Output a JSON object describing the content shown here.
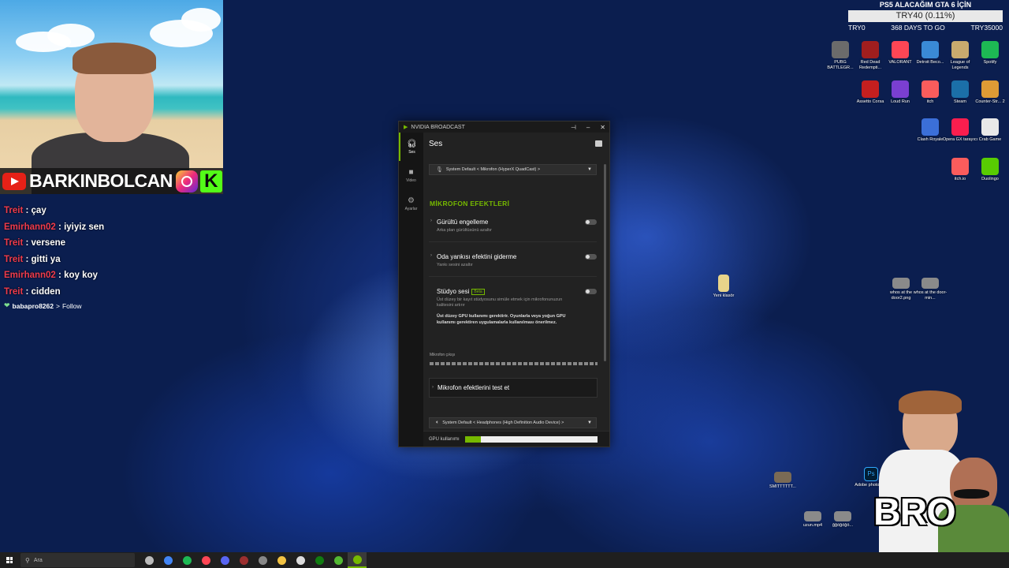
{
  "webcam": {
    "channel_name": "BARKINBOLCAN",
    "kick_letter": "K"
  },
  "chat": {
    "messages": [
      {
        "user": "Treit",
        "text": "çay"
      },
      {
        "user": "Emirhann02",
        "text": "iyiyiz sen"
      },
      {
        "user": "Treit",
        "text": "versene"
      },
      {
        "user": "Treit",
        "text": "gitti ya"
      },
      {
        "user": "Emirhann02",
        "text": "koy koy"
      },
      {
        "user": "Treit",
        "text": "cidden"
      }
    ],
    "follow": {
      "user": "babapro8262",
      "text": "Follow"
    },
    "separator": " : "
  },
  "goal": {
    "title": "PS5 ALACAĞIM GTA 6 İÇİN",
    "progress_text": "TRY40 (0.11%)",
    "start": "TRY0",
    "days_left": "368 DAYS TO GO",
    "target": "TRY35000"
  },
  "desktop_icons": {
    "row1": [
      {
        "label": "PUBG BATTLEGR...",
        "color": "#6b6b6b"
      },
      {
        "label": "Red Dead Redempti...",
        "color": "#a01e1e"
      },
      {
        "label": "VALORANT",
        "color": "#ff4655"
      },
      {
        "label": "Detroit Beco...",
        "color": "#3a8ad6"
      },
      {
        "label": "League of Legends",
        "color": "#c8aa6e"
      },
      {
        "label": "Spotify",
        "color": "#1db954"
      }
    ],
    "row2": [
      {
        "label": "Assetto Corsa",
        "color": "#c41f1f"
      },
      {
        "label": "Loud Run",
        "color": "#7a3fd1"
      },
      {
        "label": "itch",
        "color": "#fa5c5c"
      },
      {
        "label": "Steam",
        "color": "#1b6fa8"
      },
      {
        "label": "Counter-Str... 2",
        "color": "#de9b35"
      }
    ],
    "row3": [
      {
        "label": "Clash Royale",
        "color": "#3b6fd8"
      },
      {
        "label": "Opera GX tarayıcı",
        "color": "#fa1e4e"
      },
      {
        "label": "Crab Game",
        "color": "#e8e8e8"
      }
    ],
    "row4": [
      {
        "label": "itch.io",
        "color": "#fa5c5c"
      },
      {
        "label": "Duolingo",
        "color": "#58cc02"
      }
    ],
    "loose": [
      {
        "label": "Yeni klasör"
      },
      {
        "label": "whos at the door2.png"
      },
      {
        "label": "whos at the door-min..."
      },
      {
        "label": "SMITTTTTT..."
      },
      {
        "label": "Adobe photosh..."
      },
      {
        "label": "uzun.mp4"
      },
      {
        "label": "ğğöğöğö..."
      }
    ]
  },
  "broadcast": {
    "window_title": "NVIDIA BROADCAST",
    "sidebar": [
      {
        "label": "Ses",
        "icon": "headset-icon"
      },
      {
        "label": "Video",
        "icon": "camera-icon"
      },
      {
        "label": "Ayarlar",
        "icon": "gear-icon"
      }
    ],
    "page_title": "Ses",
    "mic_source": "System Default < Mikrofon (HyperX QuadCast) >",
    "section_title": "MİKROFON EFEKTLERİ",
    "effects": [
      {
        "title": "Gürültü engelleme",
        "subtitle": "Arka plan gürültüsünü azaltır",
        "enabled": false
      },
      {
        "title": "Oda yankısı efektini giderme",
        "subtitle": "Yankı sesini azaltır",
        "enabled": false
      },
      {
        "title": "Stüdyo sesi",
        "badge": "Beta",
        "subtitle": "Üst düzey bir kayıt stüdyosunu simüle etmek için mikrofonunuzun kalitesini artırır",
        "warning": "Üst düzey GPU kullanımı gerektirir. Oyunlarla veya yoğun GPU kullanımı gerektiren uygulamalarla kullanılması önerilmez.",
        "enabled": false
      }
    ],
    "meter_label": "Mikrofon çıkışı",
    "test_label": "Mikrofon efektlerini test et",
    "speaker_source": "System Default < Headphones (High Definition Audio Device) >",
    "gpu_label": "GPU kullanımı",
    "gpu_usage_fraction": 0.12,
    "accent_color": "#76b900"
  },
  "taskbar": {
    "search_placeholder": "Ara",
    "apps": [
      {
        "name": "xbox-bar-icon",
        "color": "#bbbbbb"
      },
      {
        "name": "chrome-icon",
        "color": "#4285f4"
      },
      {
        "name": "spotify-icon",
        "color": "#1db954"
      },
      {
        "name": "valorant-icon",
        "color": "#ff4655"
      },
      {
        "name": "discord-icon",
        "color": "#5865f2"
      },
      {
        "name": "obs-icon",
        "color": "#9b2f2f"
      },
      {
        "name": "calculator-icon",
        "color": "#888888"
      },
      {
        "name": "explorer-icon",
        "color": "#f3c343"
      },
      {
        "name": "capcut-icon",
        "color": "#dddddd"
      },
      {
        "name": "xbox-icon",
        "color": "#107c10"
      },
      {
        "name": "gamepass-icon",
        "color": "#53b833"
      },
      {
        "name": "nvidia-broadcast-icon",
        "color": "#76b900",
        "active": true
      }
    ]
  },
  "overlay": {
    "meme_text": "BRO"
  }
}
